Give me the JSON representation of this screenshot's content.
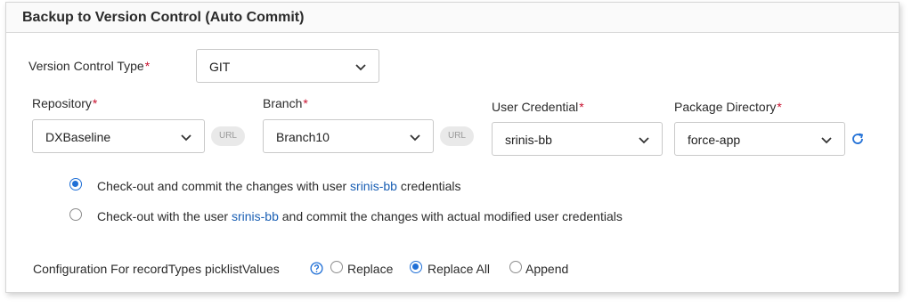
{
  "panel": {
    "title": "Backup to Version Control (Auto Commit)"
  },
  "version_control_type": {
    "label": "Version Control Type",
    "value": "GIT"
  },
  "repository": {
    "label": "Repository",
    "value": "DXBaseline",
    "url_badge": "URL"
  },
  "branch": {
    "label": "Branch",
    "value": "Branch10",
    "url_badge": "URL"
  },
  "user_credential": {
    "label": "User Credential",
    "value": "srinis-bb"
  },
  "package_directory": {
    "label": "Package Directory",
    "value": "force-app",
    "refresh_icon": "refresh-icon"
  },
  "required_mark": "*",
  "commit_options": [
    {
      "prefix": "Check-out and commit the changes with user ",
      "user": "srinis-bb",
      "suffix": " credentials",
      "selected": true
    },
    {
      "prefix": "Check-out with the user ",
      "user": "srinis-bb",
      "suffix": " and commit the changes with actual modified user credentials",
      "selected": false
    }
  ],
  "picklist_config": {
    "label": "Configuration For recordTypes picklistValues",
    "help_icon": "help-icon",
    "options": [
      {
        "label": "Replace",
        "selected": false
      },
      {
        "label": "Replace All",
        "selected": true
      },
      {
        "label": "Append",
        "selected": false
      }
    ]
  },
  "colors": {
    "accent": "#1f6fd6",
    "required": "#c8102e",
    "link": "#1a5fb4"
  }
}
